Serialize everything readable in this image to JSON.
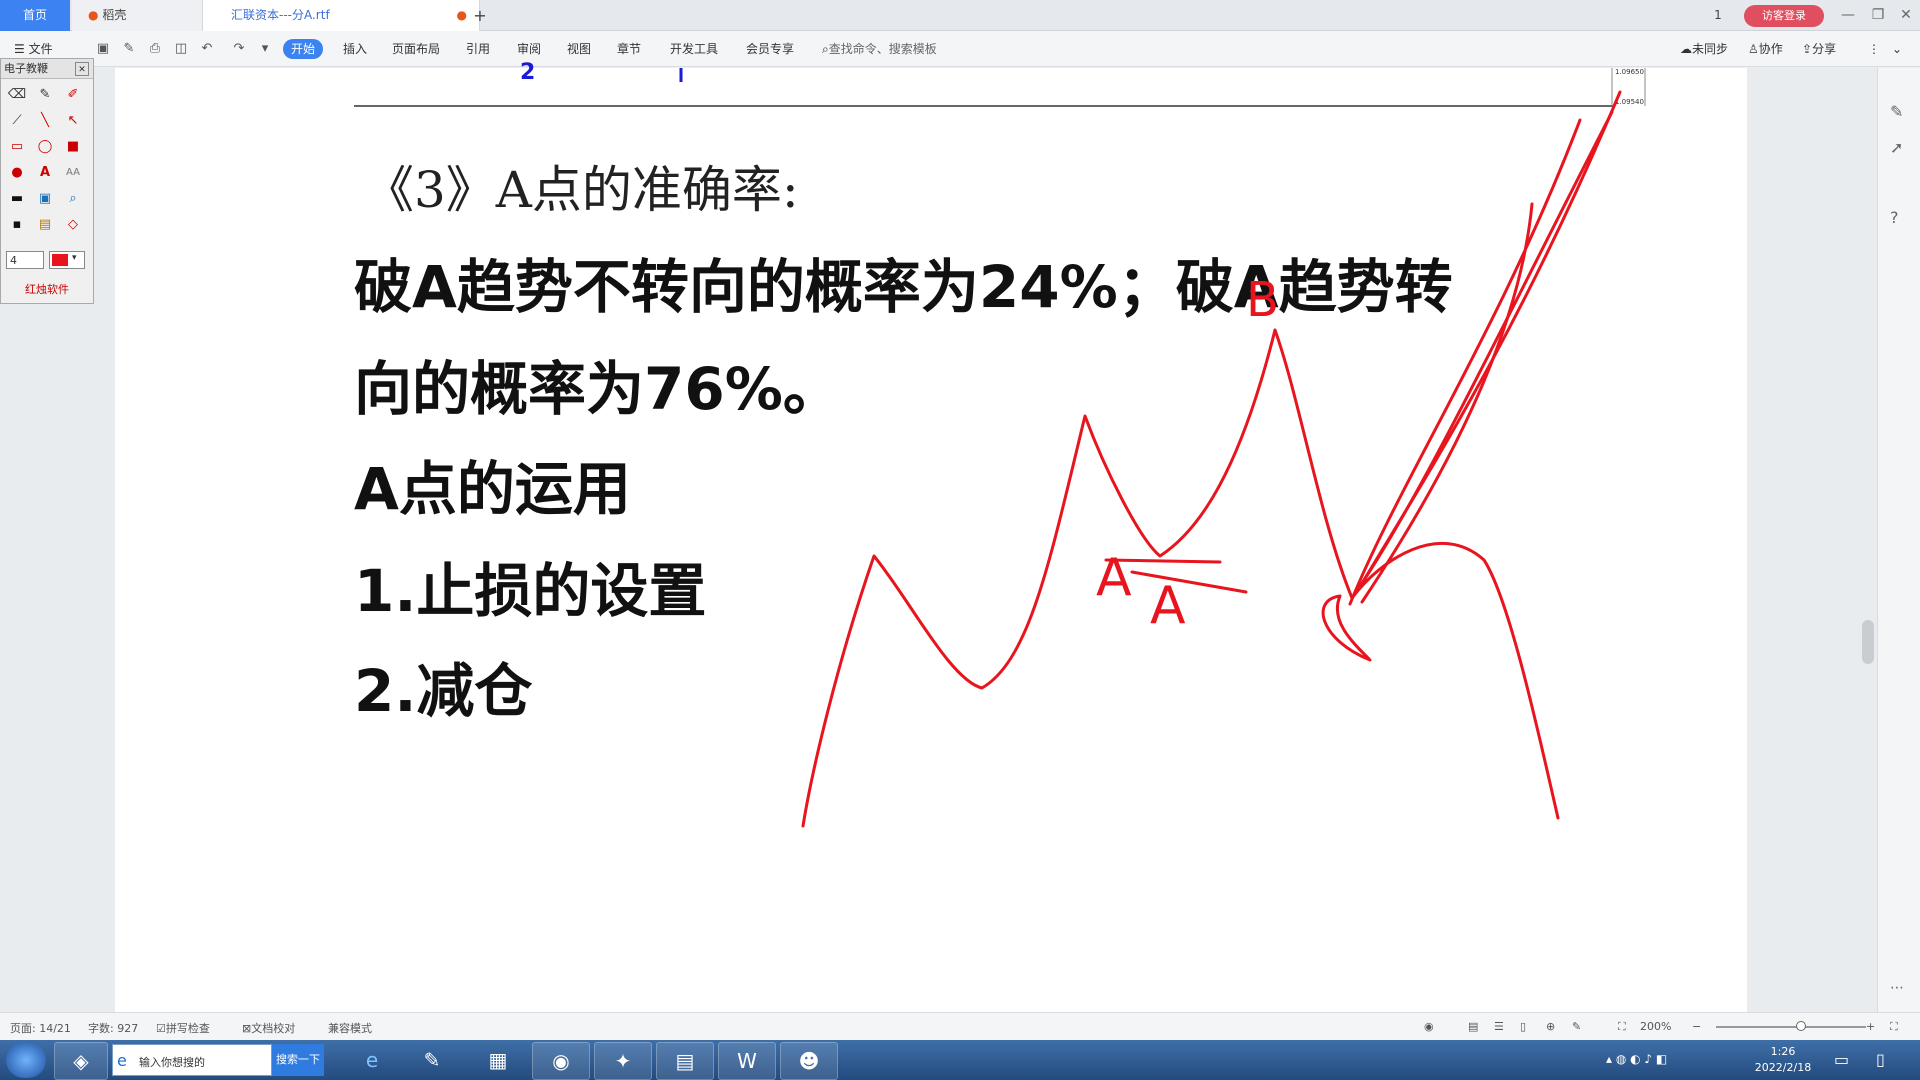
{
  "tabs": {
    "home": "首页",
    "daoke": "稻壳",
    "doc": "汇联资本---分A.rtf",
    "new_tab": "+"
  },
  "window": {
    "badge": "1",
    "login": "访客登录",
    "minimize": "—",
    "restore": "❐",
    "close": "✕"
  },
  "ribbon": {
    "file": "文件",
    "menus": [
      "开始",
      "插入",
      "页面布局",
      "引用",
      "审阅",
      "视图",
      "章节",
      "开发工具",
      "会员专享"
    ],
    "search": "查找命令、搜索模板",
    "unsynced": "未同步",
    "collab": "协作",
    "share": "分享"
  },
  "palette": {
    "title": "电子教鞭",
    "size_value": "4",
    "footer": "红烛软件"
  },
  "document": {
    "heading": "《3》A点的准确率:",
    "line1": "破A趋势不转向的概率为24%；破A趋势转",
    "line2": "向的概率为76%。",
    "line3": "A点的运用",
    "line4": "1.止损的设置",
    "line5": "2.减仓",
    "table_fragment": "2",
    "axis_top": "1.09650",
    "axis_bottom": "1.09540"
  },
  "annotations": {
    "label_b": "B",
    "label_a1": "A",
    "label_a2": "A",
    "ink_color": "#e8141e"
  },
  "statusbar": {
    "page": "页面: 14/21",
    "words": "字数: 927",
    "spell": "拼写检查",
    "proof": "文档校对",
    "compat": "兼容模式",
    "zoom": "200%"
  },
  "taskbar": {
    "search_placeholder": "输入你想搜的",
    "search_button": "搜索一下",
    "time": "1:26",
    "date": "2022/2/18"
  }
}
